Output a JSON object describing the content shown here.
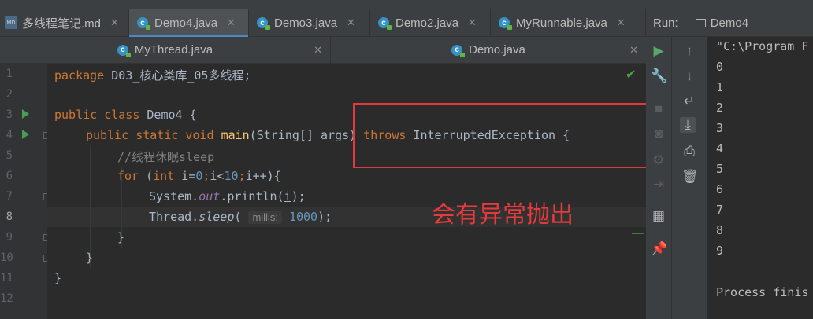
{
  "tabs": [
    {
      "label": "多线程笔记.md",
      "icon": "markdown-file-icon",
      "active": false
    },
    {
      "label": "Demo4.java",
      "icon": "java-class-icon",
      "active": true
    },
    {
      "label": "Demo3.java",
      "icon": "java-class-icon",
      "active": false
    },
    {
      "label": "Demo2.java",
      "icon": "java-class-icon",
      "active": false
    },
    {
      "label": "MyRunnable.java",
      "icon": "java-class-icon",
      "active": false
    }
  ],
  "tabs_row2": [
    {
      "label": "MyThread.java",
      "icon": "java-class-icon"
    },
    {
      "label": "Demo.java",
      "icon": "java-class-icon"
    }
  ],
  "run_panel": {
    "label": "Run:",
    "config": "Demo4"
  },
  "line_numbers": [
    "1",
    "2",
    "3",
    "4",
    "5",
    "6",
    "7",
    "8",
    "9",
    "10",
    "11",
    "12"
  ],
  "code": {
    "l1_kw": "package",
    "l1_pkg": " D03_核心类库_05多线程;",
    "l3_kw": "public class",
    "l3_name": " Demo4 {",
    "l4_kw1": "public static void ",
    "l4_fn": "main",
    "l4_a": "(String[] args) ",
    "l4_kw2": "throws",
    "l4_b": " InterruptedException {",
    "l5_comment": "//线程休眠sleep",
    "l6_for": "for",
    "l6_a": " (",
    "l6_int": "int ",
    "l6_i": "i",
    "l6_eq": "=",
    "l6_0": "0",
    "l6_semi": ";",
    "l6_i2": "i",
    "l6_lt": "<",
    "l6_10": "10",
    "l6_semi2": ";",
    "l6_i3": "i",
    "l6_end": "++){",
    "l7_a": "System.",
    "l7_out": "out",
    "l7_b": ".println(",
    "l7_i": "i",
    "l7_c": ");",
    "l8_a": "Thread.",
    "l8_sleep": "sleep",
    "l8_b": "(",
    "l8_hint": "millis:",
    "l8_num": "1000",
    "l8_c": ");",
    "l9": "}",
    "l10": "}",
    "l11": "}"
  },
  "annotation": "会有异常抛出",
  "console": {
    "first": "\"C:\\Program F",
    "outputs": [
      "0",
      "1",
      "2",
      "3",
      "4",
      "5",
      "6",
      "7",
      "8",
      "9"
    ],
    "last": "Process finis"
  },
  "colors": {
    "highlight_box": "#e03a3a",
    "annotation": "#e8393b",
    "accent": "#4a88c7"
  }
}
